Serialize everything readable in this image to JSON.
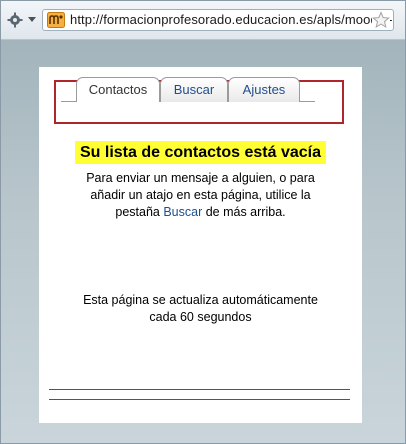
{
  "browser": {
    "url": "http://formacionprofesorado.educacion.es/apls/moodle-",
    "nav_icon": "gear-icon",
    "dropdown_icon": "dropdown-arrow-icon",
    "site_icon": "moodle-icon",
    "bookmark_icon": "star-icon"
  },
  "tabs": [
    {
      "label": "Contactos",
      "selected": true
    },
    {
      "label": "Buscar",
      "selected": false
    },
    {
      "label": "Ajustes",
      "selected": false
    }
  ],
  "message": {
    "heading": "Su lista de contactos está vacía",
    "help_before": "Para enviar un mensaje a alguien, o para añadir un atajo en esta página, utilice la pestaña ",
    "help_link": "Buscar",
    "help_after": " de más arriba.",
    "refresh_line1": "Esta página se actualiza automáticamente",
    "refresh_line2": "cada 60 segundos"
  },
  "colors": {
    "highlight": "#ffff33",
    "annotation_border": "#b0252a",
    "link": "#1f4e8c"
  }
}
